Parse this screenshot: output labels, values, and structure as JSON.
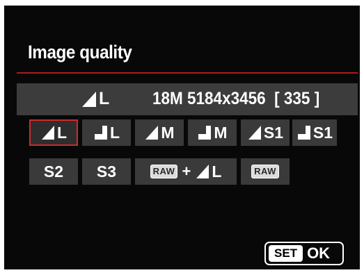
{
  "screen": {
    "title": "Image quality"
  },
  "status": {
    "selected_quality_icon": "fine-quality-icon",
    "selected_size": "L",
    "resolution_text": "18M 5184x3456",
    "shots_remaining": "[ 335 ]"
  },
  "options": [
    {
      "icon": "fine-quality-icon",
      "label": "L",
      "selected": true
    },
    {
      "icon": "normal-quality-icon",
      "label": "L",
      "selected": false
    },
    {
      "icon": "fine-quality-icon",
      "label": "M",
      "selected": false
    },
    {
      "icon": "normal-quality-icon",
      "label": "M",
      "selected": false
    },
    {
      "icon": "fine-quality-icon",
      "label": "S1",
      "selected": false
    },
    {
      "icon": "normal-quality-icon",
      "label": "S1",
      "selected": false
    },
    {
      "label": "S2",
      "selected": false
    },
    {
      "label": "S3",
      "selected": false
    },
    {
      "raw_label": "RAW",
      "plus": "+",
      "icon": "fine-quality-icon",
      "label": "L",
      "selected": false
    },
    {
      "raw_label": "RAW",
      "selected": false
    }
  ],
  "footer": {
    "set_label": "SET",
    "ok_label": "OK"
  },
  "colors": {
    "accent": "#d22a2a",
    "rule": "#b01c1c",
    "tile": "#3a3a3a",
    "background": "#080808"
  }
}
